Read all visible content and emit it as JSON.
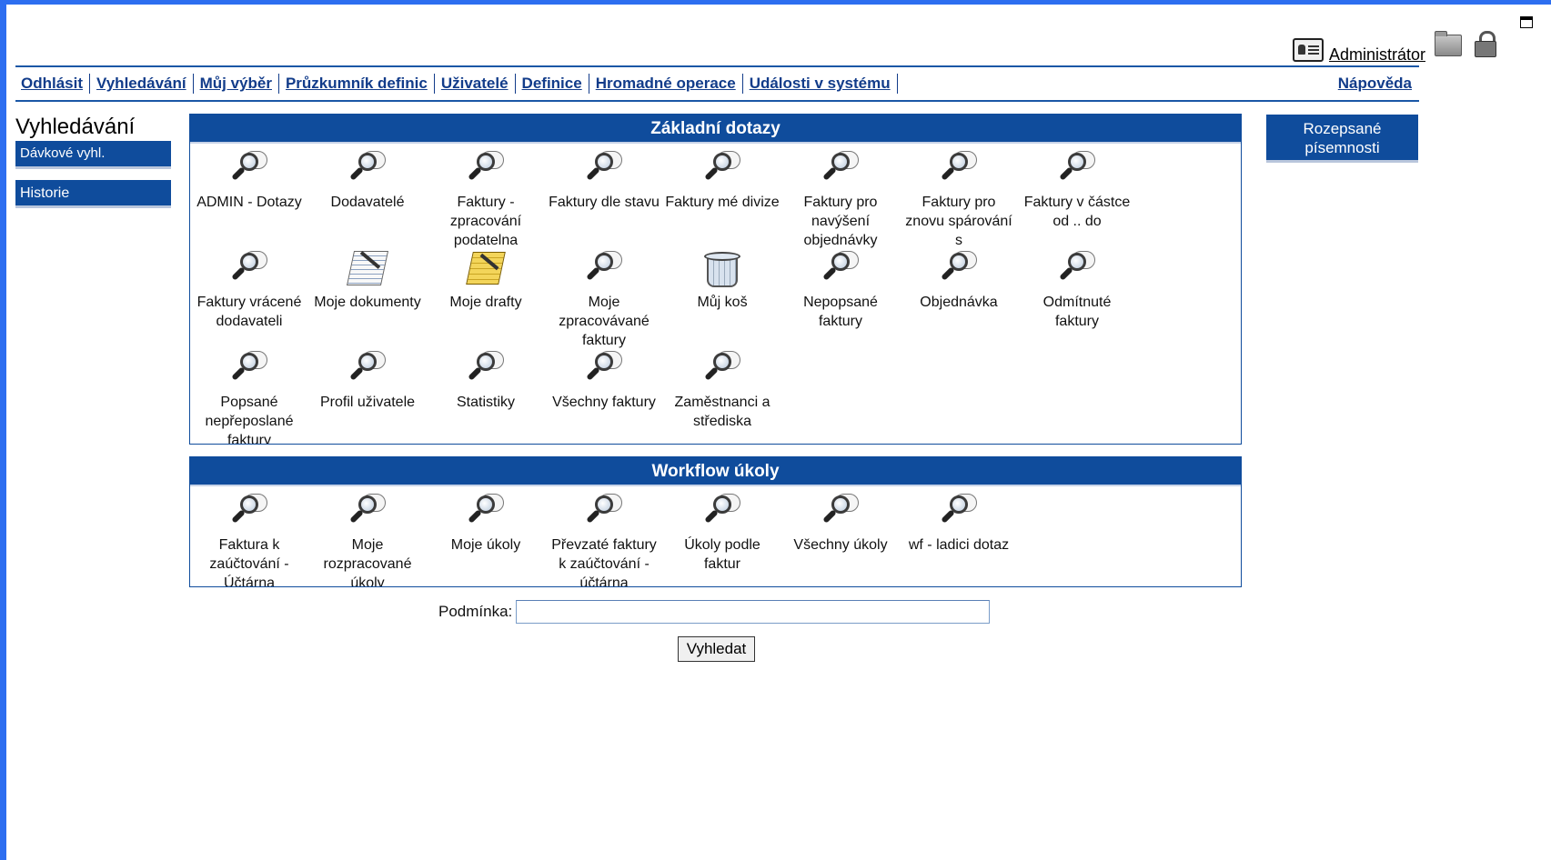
{
  "header": {
    "user_name": "Administrátor",
    "icons": [
      "user-card-icon",
      "folder-icon",
      "lock-icon",
      "maximize-icon"
    ]
  },
  "menu": {
    "items": [
      {
        "label": "Odhlásit"
      },
      {
        "label": "Vyhledávání"
      },
      {
        "label": "Můj výběr"
      },
      {
        "label": "Průzkumník definic"
      },
      {
        "label": "Uživatelé"
      },
      {
        "label": "Definice"
      },
      {
        "label": "Hromadné operace"
      },
      {
        "label": "Události v systému"
      }
    ],
    "help": "Nápověda"
  },
  "sidebar": {
    "title": "Vyhledávání",
    "buttons": [
      {
        "label": "Dávkové vyhl."
      },
      {
        "label": "Historie"
      }
    ]
  },
  "right_panel": {
    "button_label": "Rozepsané písemnosti"
  },
  "panels": {
    "basic": {
      "title": "Základní dotazy",
      "items": [
        {
          "label": "ADMIN - Dotazy",
          "icon": "query-icon"
        },
        {
          "label": "Dodavatelé",
          "icon": "query-icon"
        },
        {
          "label": "Faktury - zpracování podatelna",
          "icon": "query-icon"
        },
        {
          "label": "Faktury dle stavu",
          "icon": "query-icon"
        },
        {
          "label": "Faktury mé divize",
          "icon": "query-icon"
        },
        {
          "label": "Faktury pro navýšení objednávky",
          "icon": "query-icon"
        },
        {
          "label": "Faktury pro znovu spárování s",
          "icon": "query-icon"
        },
        {
          "label": "Faktury v částce od .. do",
          "icon": "query-icon"
        },
        {
          "label": "Faktury vrácené dodavateli",
          "icon": "query-icon"
        },
        {
          "label": "Moje dokumenty",
          "icon": "documents-icon"
        },
        {
          "label": "Moje drafty",
          "icon": "drafts-icon"
        },
        {
          "label": "Moje zpracovávané faktury",
          "icon": "query-icon"
        },
        {
          "label": "Můj koš",
          "icon": "trash-icon"
        },
        {
          "label": "Nepopsané faktury",
          "icon": "query-icon"
        },
        {
          "label": "Objednávka",
          "icon": "query-icon"
        },
        {
          "label": "Odmítnuté faktury",
          "icon": "query-icon"
        },
        {
          "label": "Popsané nepřeposlané faktury",
          "icon": "query-icon"
        },
        {
          "label": "Profil uživatele",
          "icon": "query-icon"
        },
        {
          "label": "Statistiky",
          "icon": "query-icon"
        },
        {
          "label": "Všechny faktury",
          "icon": "query-icon"
        },
        {
          "label": "Zaměstnanci a střediska",
          "icon": "query-icon"
        }
      ]
    },
    "workflow": {
      "title": "Workflow úkoly",
      "items": [
        {
          "label": "Faktura k zaúčtování - Účtárna",
          "icon": "query-icon"
        },
        {
          "label": "Moje rozpracované úkoly",
          "icon": "query-icon"
        },
        {
          "label": "Moje úkoly",
          "icon": "query-icon"
        },
        {
          "label": "Převzaté faktury k zaúčtování - účtárna",
          "icon": "query-icon"
        },
        {
          "label": "Úkoly podle faktur",
          "icon": "query-icon"
        },
        {
          "label": "Všechny úkoly",
          "icon": "query-icon"
        },
        {
          "label": "wf - ladici dotaz",
          "icon": "query-icon"
        }
      ]
    }
  },
  "search": {
    "condition_label": "Podmínka:",
    "condition_value": "",
    "condition_placeholder": "",
    "submit_label": "Vyhledat"
  },
  "colors": {
    "accent": "#0f4c9c",
    "frame": "#2d6ef0",
    "menu_text": "#123c8a"
  }
}
